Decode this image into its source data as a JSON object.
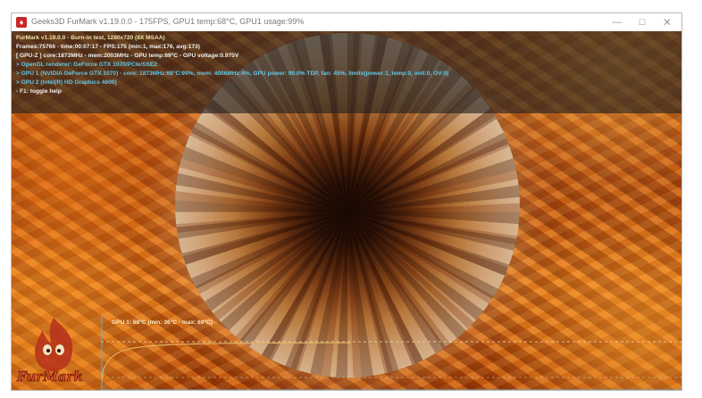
{
  "window": {
    "title": "Geeks3D FurMark v1.19.0.0 - 175FPS, GPU1 temp:68°C, GPU1 usage:99%",
    "controls": {
      "minimize": "—",
      "maximize": "☐",
      "close": "✕"
    },
    "icon": "furmark-app-icon"
  },
  "hud": {
    "lines": [
      "FurMark v1.19.0.0 - Burn-in test, 1280x720 (8X MSAA)",
      "Frames:75766 - time:00:07:17 - FPS:175 (min:1, max:176, avg:173)",
      "[ GPU-Z ] core:1873MHz - mem:2003MHz - GPU temp:69°C - GPU voltage:0.975V",
      "> OpenGL renderer: GeForce GTX 1070/PCIe/SSE2",
      "> GPU 1 (NVIDIA GeForce GTX 1070) - core: 1873MHz:68°C:99%, mem: 4006MHz:4%, GPU power: 90.0% TDP, fan: 45%, limits(power:1, temp:0, volt:0, OV:0)",
      "> GPU 2 (Intel(R) HD Graphics 4600)",
      "- F1: toggle help"
    ]
  },
  "graph": {
    "label": "GPU 1: 68°C (min: 36°C - max: 69°C)",
    "series_color": "#e0b060",
    "temps_min": 36,
    "temps_max": 69,
    "current": 68
  },
  "logo": {
    "text": "FurMark",
    "icon": "furmark-flame-logo"
  },
  "colors": {
    "hud_yellow": "#f2e6a8",
    "hud_cyan": "#61c7e8",
    "fire_orange": "#d1651a"
  }
}
